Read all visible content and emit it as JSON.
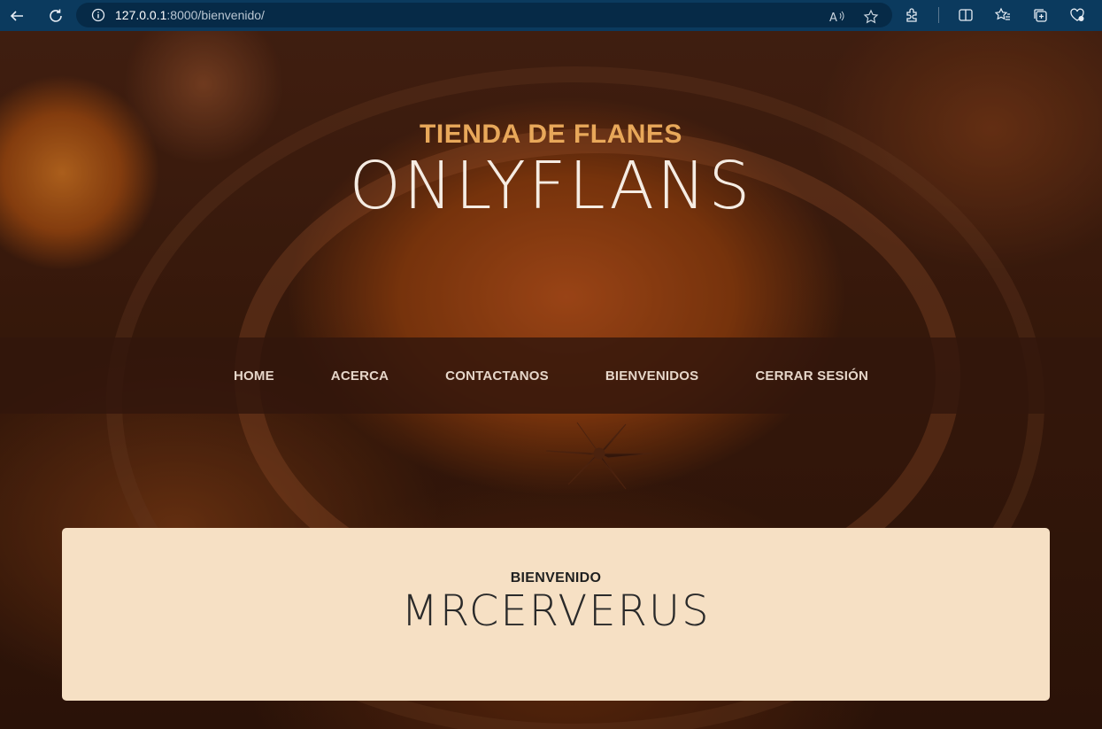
{
  "browser": {
    "url_host": "127.0.0.1",
    "url_path": ":8000/bienvenido/",
    "icons": [
      "back-icon",
      "reload-icon",
      "info-icon",
      "read-aloud-icon",
      "favorite-star-icon",
      "extensions-icon",
      "split-screen-icon",
      "favorites-icon",
      "collections-icon",
      "browser-essentials-icon"
    ]
  },
  "header": {
    "subtitle": "TIENDA DE FLANES",
    "title": "ONLYFLANS"
  },
  "nav": {
    "items": [
      {
        "label": "HOME"
      },
      {
        "label": "ACERCA"
      },
      {
        "label": "CONTACTANOS"
      },
      {
        "label": "BIENVENIDOS"
      },
      {
        "label": "CERRAR SESIÓN"
      }
    ]
  },
  "welcome": {
    "label": "BIENVENIDO",
    "username": "MRCERVERUS"
  },
  "colors": {
    "chrome_bg": "#0b3a5e",
    "subtitle": "#e8a85a",
    "card_bg": "#f6e0c4",
    "navbar_bg": "#32160c"
  }
}
